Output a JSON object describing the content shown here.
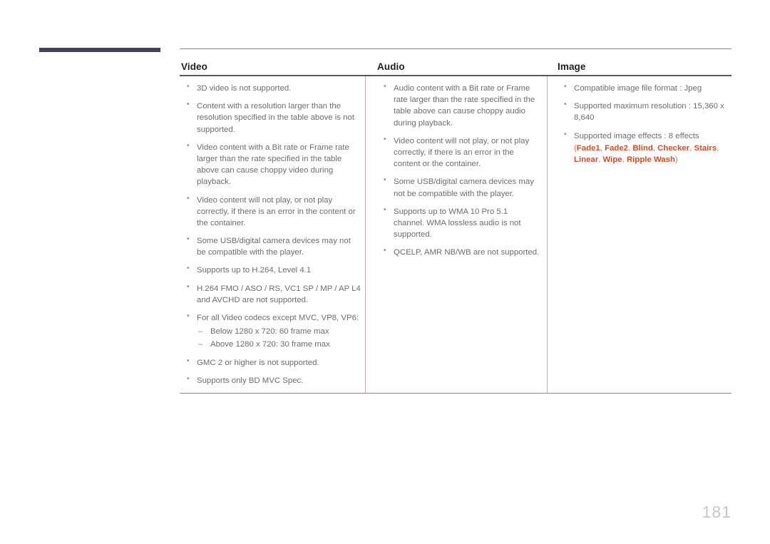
{
  "page": {
    "number": "181"
  },
  "table": {
    "columns": [
      {
        "header": "Video"
      },
      {
        "header": "Audio"
      },
      {
        "header": "Image"
      }
    ],
    "video_items": [
      "3D video is not supported.",
      "Content with a resolution larger than the resolution specified in the table above is not supported.",
      "Video content with a Bit rate or Frame rate larger than the rate specified in the table above can cause choppy video during playback.",
      "Video content will not play, or not play correctly, if there is an error in the content or the container.",
      "Some USB/digital camera devices may not be compatible with the player.",
      "Supports up to H.264, Level 4.1",
      "H.264 FMO / ASO / RS, VC1 SP / MP / AP L4 and AVCHD are not supported.",
      "For all Video codecs except MVC, VP8, VP6:",
      "GMC 2 or higher is not supported.",
      "Supports only BD MVC Spec."
    ],
    "video_sub_items": [
      "Below 1280 x 720: 60 frame max",
      "Above 1280 x 720: 30 frame max"
    ],
    "audio_items": [
      "Audio content with a Bit rate or Frame rate larger than the rate specified in the table above can cause choppy audio during playback.",
      "Video content will not play, or not play correctly, if there is an error in the content or the container.",
      "Some USB/digital camera devices may not be compatible with the player.",
      "Supports up to WMA 10 Pro 5.1 channel. WMA lossless audio is not supported.",
      "QCELP, AMR NB/WB are not supported."
    ],
    "image_items": [
      "Compatible image file format : Jpeg",
      "Supported maximum resolution : 15,360 x 8,640",
      "Supported image effects : 8 effects"
    ],
    "image_effects": {
      "open_paren": "(",
      "close_paren": ")",
      "separator": ", ",
      "names": [
        "Fade1",
        "Fade2",
        "Blind",
        "Checker",
        "Stairs",
        "Linear",
        "Wipe",
        "Ripple Wash"
      ]
    }
  },
  "colors": {
    "deco_bar": "#43425a",
    "accent_effect": "#e0491f",
    "body_text": "#6f6c71",
    "header_text": "#231f20",
    "page_number": "#c6c3d2",
    "divider": "#c9a8ae"
  }
}
